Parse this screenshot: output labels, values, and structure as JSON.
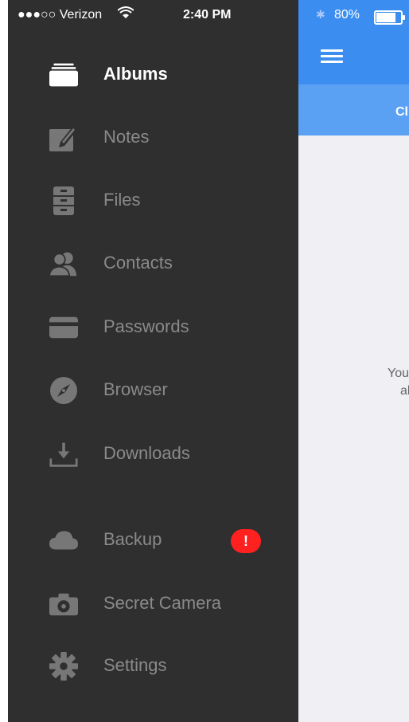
{
  "status": {
    "carrier": "●●●○○ Verizon",
    "time": "2:40 PM",
    "battery": "80%"
  },
  "main": {
    "subbar_text": "Cl",
    "empty_text_line1": "You",
    "empty_text_line2": "al"
  },
  "drawer": {
    "items": [
      {
        "label": "Albums"
      },
      {
        "label": "Notes"
      },
      {
        "label": "Files"
      },
      {
        "label": "Contacts"
      },
      {
        "label": "Passwords"
      },
      {
        "label": "Browser"
      },
      {
        "label": "Downloads"
      },
      {
        "label": "Backup",
        "badge": "!"
      },
      {
        "label": "Secret Camera"
      },
      {
        "label": "Settings"
      }
    ]
  },
  "colors": {
    "drawer_bg": "#2f2f2f",
    "topbar": "#3b8ef0",
    "subbar": "#5aa1f3",
    "badge": "#ff2020"
  }
}
